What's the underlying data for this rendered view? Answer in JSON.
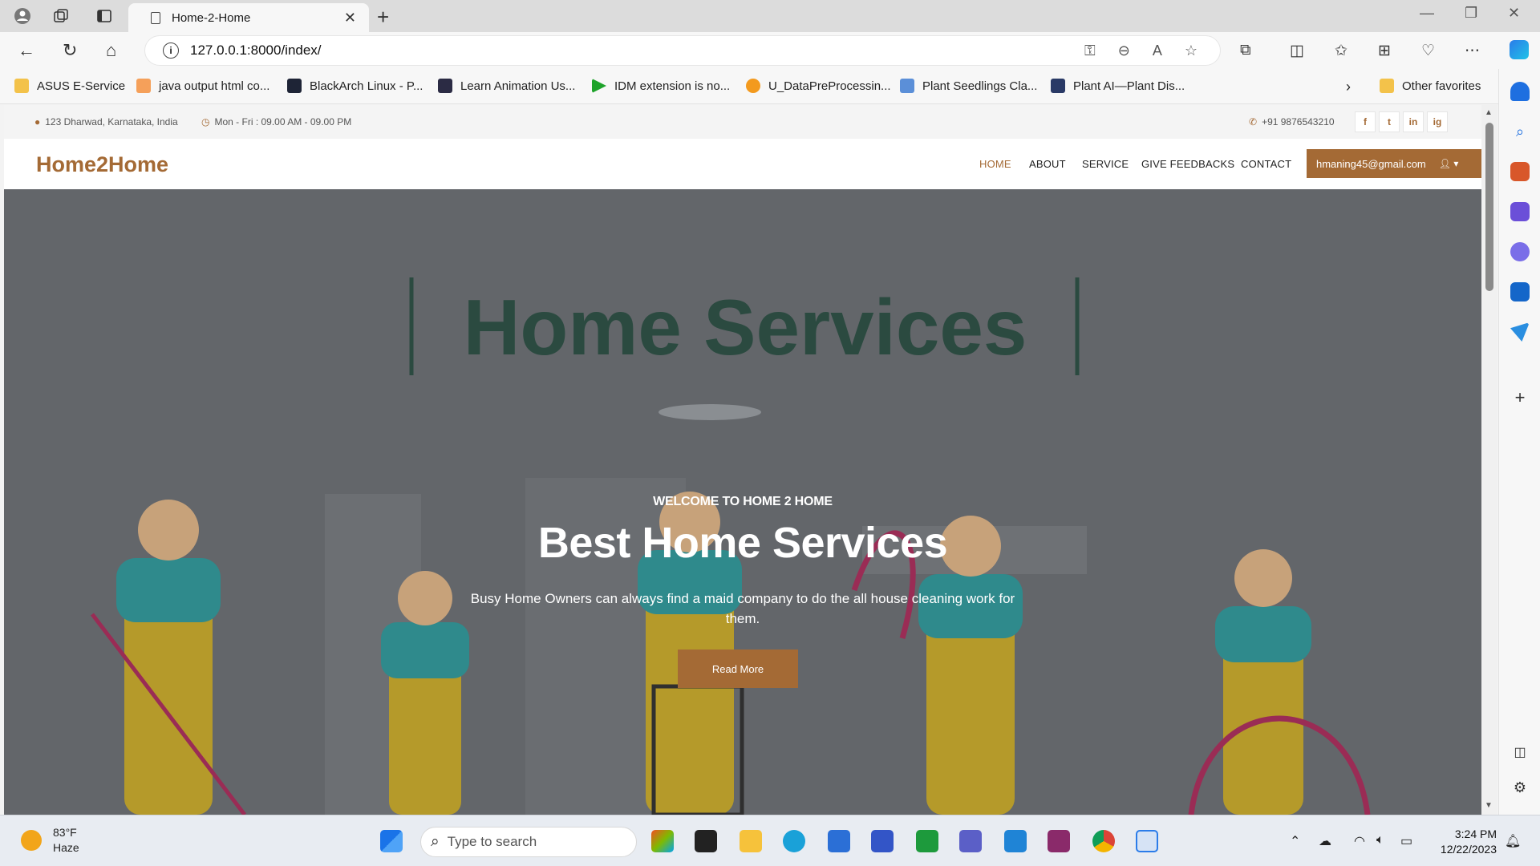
{
  "browser": {
    "tab_title": "Home-2-Home",
    "url": "127.0.0.1:8000/index/",
    "favorites": [
      {
        "label": "ASUS E-Service",
        "icon": "folder-icon"
      },
      {
        "label": "java output html co...",
        "icon": "bookmark-icon"
      },
      {
        "label": "BlackArch Linux - P...",
        "icon": "blackarch-icon"
      },
      {
        "label": "Learn Animation Us...",
        "icon": "animation-icon"
      },
      {
        "label": "IDM extension is no...",
        "icon": "idm-icon"
      },
      {
        "label": "U_DataPreProcessin...",
        "icon": "colab-icon"
      },
      {
        "label": "Plant Seedlings Cla...",
        "icon": "chart-icon"
      },
      {
        "label": "Plant AI—Plant Dis...",
        "icon": "tds-icon"
      }
    ],
    "other_favorites": "Other favorites"
  },
  "site": {
    "topbar": {
      "address": "123 Dharwad, Karnataka, India",
      "hours": "Mon - Fri : 09.00 AM - 09.00 PM",
      "phone": "+91 9876543210",
      "social": [
        "f",
        "t",
        "in",
        "ig"
      ]
    },
    "logo": "Home2Home",
    "menu": [
      "HOME",
      "ABOUT",
      "SERVICE",
      "GIVE FEEDBACKS",
      "CONTACT"
    ],
    "active_menu": "HOME",
    "user_email": "hmaning45@gmail.com",
    "hero": {
      "image_text": "Home Services",
      "subtitle": "WELCOME TO HOME 2 HOME",
      "title": "Best Home Services",
      "description": "Busy Home Owners can always find a maid company to do the all house cleaning work for them.",
      "button": "Read More"
    },
    "accent_color": "#a46a35"
  },
  "taskbar": {
    "temperature": "83°F",
    "condition": "Haze",
    "search_placeholder": "Type to search",
    "time": "3:24 PM",
    "date": "12/22/2023"
  }
}
